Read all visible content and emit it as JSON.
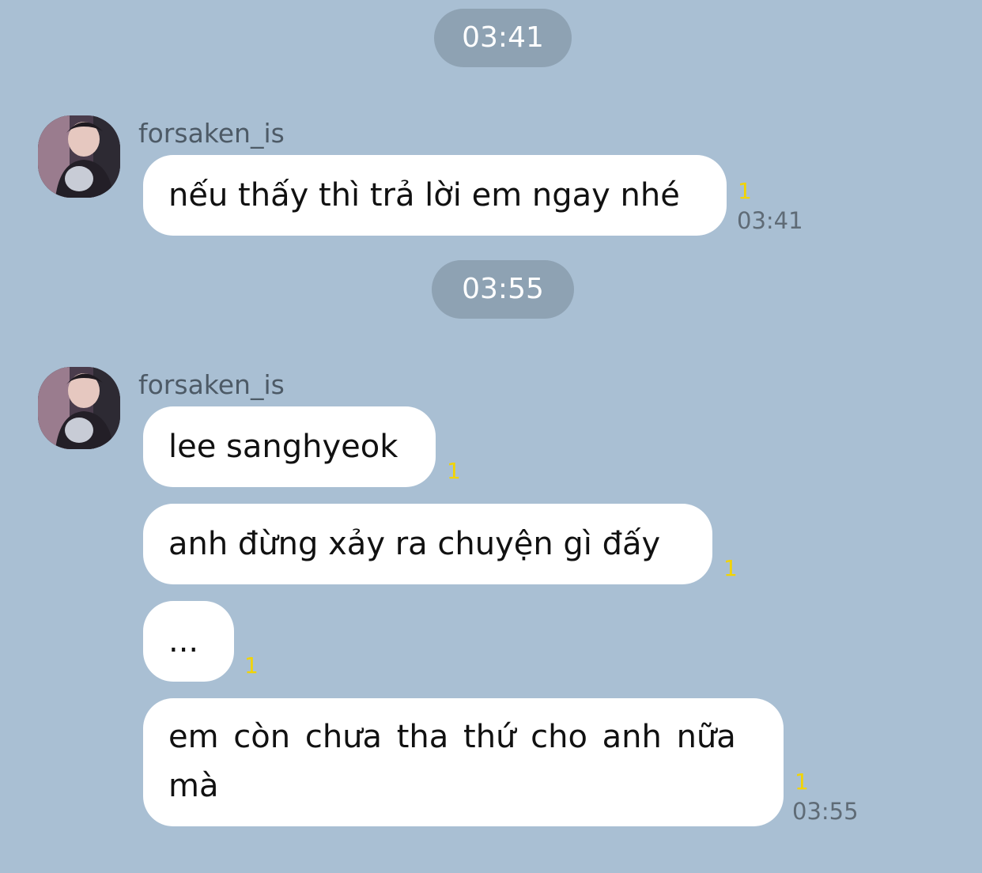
{
  "chat": {
    "separators": [
      "03:41",
      "03:55"
    ],
    "groups": [
      {
        "sender": "forsaken_is",
        "avatar_icon": "profile-photo",
        "messages": [
          {
            "text": "nếu thấy thì trả lời em ngay nhé",
            "unread": "1",
            "time": "03:41"
          }
        ]
      },
      {
        "sender": "forsaken_is",
        "avatar_icon": "profile-photo",
        "messages": [
          {
            "text": "lee sanghyeok",
            "unread": "1"
          },
          {
            "text": "anh đừng xảy ra chuyện gì đấy",
            "unread": "1"
          },
          {
            "text": "...",
            "unread": "1"
          },
          {
            "text_line1": "em còn chưa tha thứ cho anh nữa",
            "text_line2": "mà",
            "unread": "1",
            "time": "03:55"
          }
        ]
      }
    ]
  },
  "colors": {
    "background": "#a9bfd3",
    "time_pill": "#8ea2b3",
    "bubble": "#ffffff",
    "unread_count": "#f2d400"
  }
}
